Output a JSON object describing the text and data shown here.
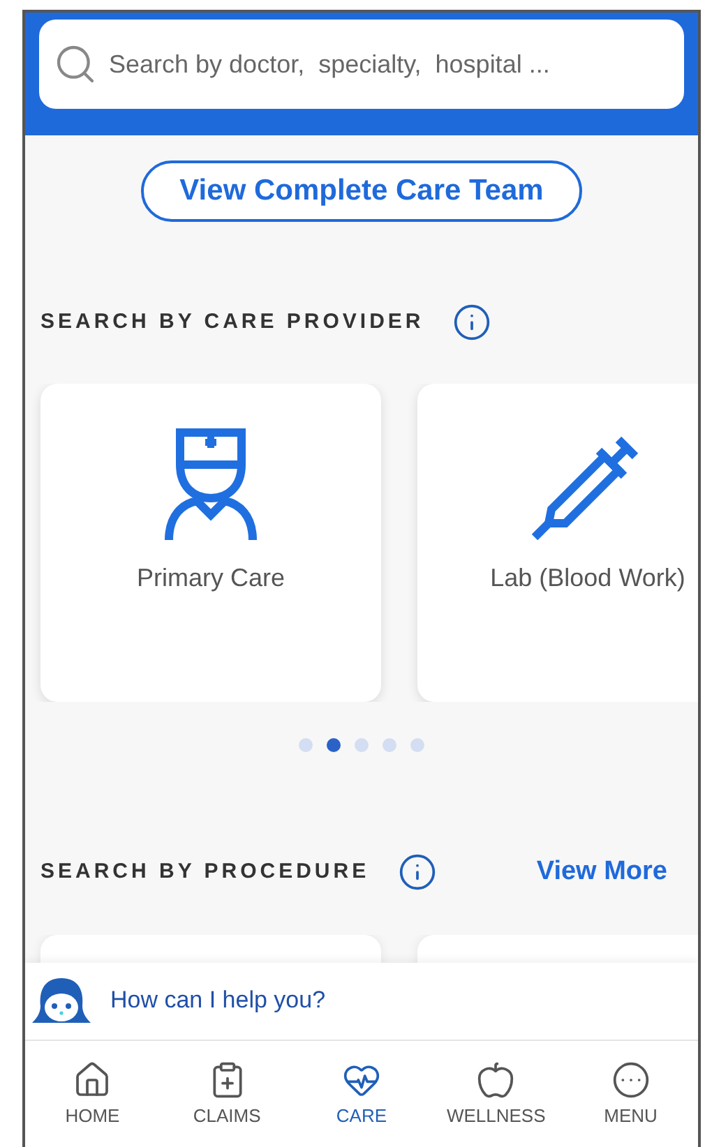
{
  "search": {
    "placeholder": "Search by doctor,  specialty,  hospital ..."
  },
  "care_team_button": "View Complete Care Team",
  "care_provider": {
    "title": "SEARCH BY CARE PROVIDER",
    "cards": [
      {
        "kind": "nurse",
        "label": "Primary Care"
      },
      {
        "kind": "syringe",
        "label": "Lab (Blood Work)"
      }
    ],
    "pager": [
      {
        "selected": false
      },
      {
        "selected": true
      },
      {
        "selected": false
      },
      {
        "selected": false
      },
      {
        "selected": false
      }
    ]
  },
  "procedure": {
    "title": "SEARCH BY PROCEDURE",
    "view_more": "View More"
  },
  "assistant": {
    "prompt": "How can I help you?"
  },
  "nav": [
    {
      "kind": "home",
      "label": "HOME",
      "selected": false
    },
    {
      "kind": "claims",
      "label": "CLAIMS",
      "selected": false
    },
    {
      "kind": "care",
      "label": "CARE",
      "selected": true
    },
    {
      "kind": "wellness",
      "label": "WELLNESS",
      "selected": false
    },
    {
      "kind": "menu",
      "label": "MENU",
      "selected": false
    }
  ]
}
